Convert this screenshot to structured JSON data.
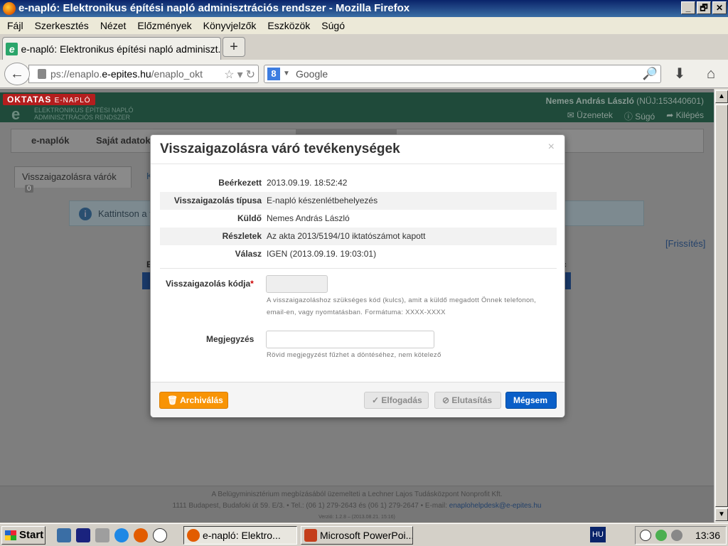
{
  "window": {
    "title": "e-napló: Elektronikus építési napló adminisztrációs rendszer - Mozilla Firefox",
    "buttons": [
      "_",
      "🗗",
      "✕"
    ]
  },
  "menubar": [
    "Fájl",
    "Szerkesztés",
    "Nézet",
    "Előzmények",
    "Könyvjelzők",
    "Eszközök",
    "Súgó"
  ],
  "tabs": [
    {
      "label": "e-napló: Elektronikus építési napló adminiszt...",
      "favicon": "e"
    }
  ],
  "newtab_label": "+",
  "navbar": {
    "url_prefix": "ps://enaplo.",
    "url_host": "e-epites.hu",
    "url_suffix": "/enaplo_okt",
    "search_engine_letter": "8",
    "search_placeholder": "Google"
  },
  "site": {
    "badge": "OKTATAS",
    "badge_small": "E-NAPLÓ",
    "logo_letter": "e",
    "subtitle_line1": "ELEKTRONIKUS ÉPÍTÉSI NAPLÓ",
    "subtitle_line2": "ADMINISZTRÁCIÓS RENDSZER",
    "user_name": "Nemes András László",
    "user_id": "(NÜJ:153440601)",
    "links": [
      "✉ Üzenetek",
      "ⓘ Súgó",
      "➦ Kilépés"
    ],
    "nav": [
      "e-naplók",
      "Saját adatok"
    ],
    "subtab1": "Visszaigazolásra várók",
    "subtab1_count": "0",
    "subtab2": "Kü",
    "info_text": "Kattintson a ta",
    "refresh": "[Frissítés]",
    "table_header_e": "E",
    "table_header_last": "c",
    "footer_line1": "A Belügyminisztérium megbízásából üzemelteti a Lechner Lajos Tudásközpont Nonprofit Kft.",
    "footer_line2": "1111 Budapest, Budafoki út 59. E/3. • Tel.: (06 1) 279-2643 és (06 1) 279-2647 • E-mail: ",
    "footer_email": "enaplohelpdesk@e-epites.hu",
    "footer_line3": "Verzió: 1.2.8 – (2013.08.21. 15:16)"
  },
  "modal": {
    "title": "Visszaigazolásra váró tevékenységek",
    "close": "×",
    "rows": [
      {
        "label": "Beérkezett",
        "value": "2013.09.19. 18:52:42"
      },
      {
        "label": "Visszaigazolás típusa",
        "value": "E-napló készenlétbehelyezés"
      },
      {
        "label": "Küldő",
        "value": "Nemes András László"
      },
      {
        "label": "Részletek",
        "value": "Az akta 2013/5194/10 iktatószámot kapott"
      },
      {
        "label": "Válasz",
        "value": "IGEN (2013.09.19. 19:03:01)"
      }
    ],
    "code_label": "Visszaigazolás kódja",
    "required_mark": "*",
    "code_help_1": "A visszaigazoláshoz szükséges kód (kulcs), amit a küldő megadott Önnek telefonon,",
    "code_help_2": "email-en, vagy nyomtatásban. Formátuma: XXXX-XXXX",
    "note_label": "Megjegyzés",
    "note_help": "Rövid megjegyzést fűzhet a döntéséhez, nem kötelező",
    "buttons": {
      "archive": "🗑 Archiválás",
      "accept": "✓ Elfogadás",
      "reject": "⊘ Elutasítás",
      "cancel": "Mégsem"
    }
  },
  "taskbar": {
    "start": "Start",
    "tasks": [
      "e-napló: Elektro...",
      "Microsoft PowerPoi..."
    ],
    "lang": "HU",
    "clock": "13:36"
  },
  "colors": {
    "archive": "#f89406",
    "cancel": "#0a5fc8",
    "header_green": "#1f4a3a"
  }
}
